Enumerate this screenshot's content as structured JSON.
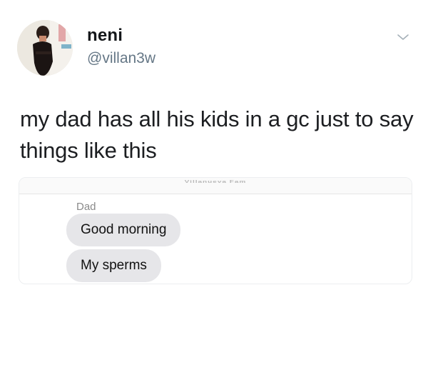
{
  "author": {
    "name": "neni",
    "handle": "@villan3w"
  },
  "icons": {
    "avatar": "profile-photo",
    "menu": "chevron-down-icon"
  },
  "tweet": {
    "text": "my dad has all his kids in a gc just to say things like this"
  },
  "screenshot": {
    "group_name": "Villanueva Fam",
    "sender": "Dad",
    "messages": [
      "Good morning",
      "My sperms"
    ]
  },
  "colors": {
    "handle": "#657786",
    "bubble": "#e6e6e9",
    "heart": "#b04aa6"
  }
}
